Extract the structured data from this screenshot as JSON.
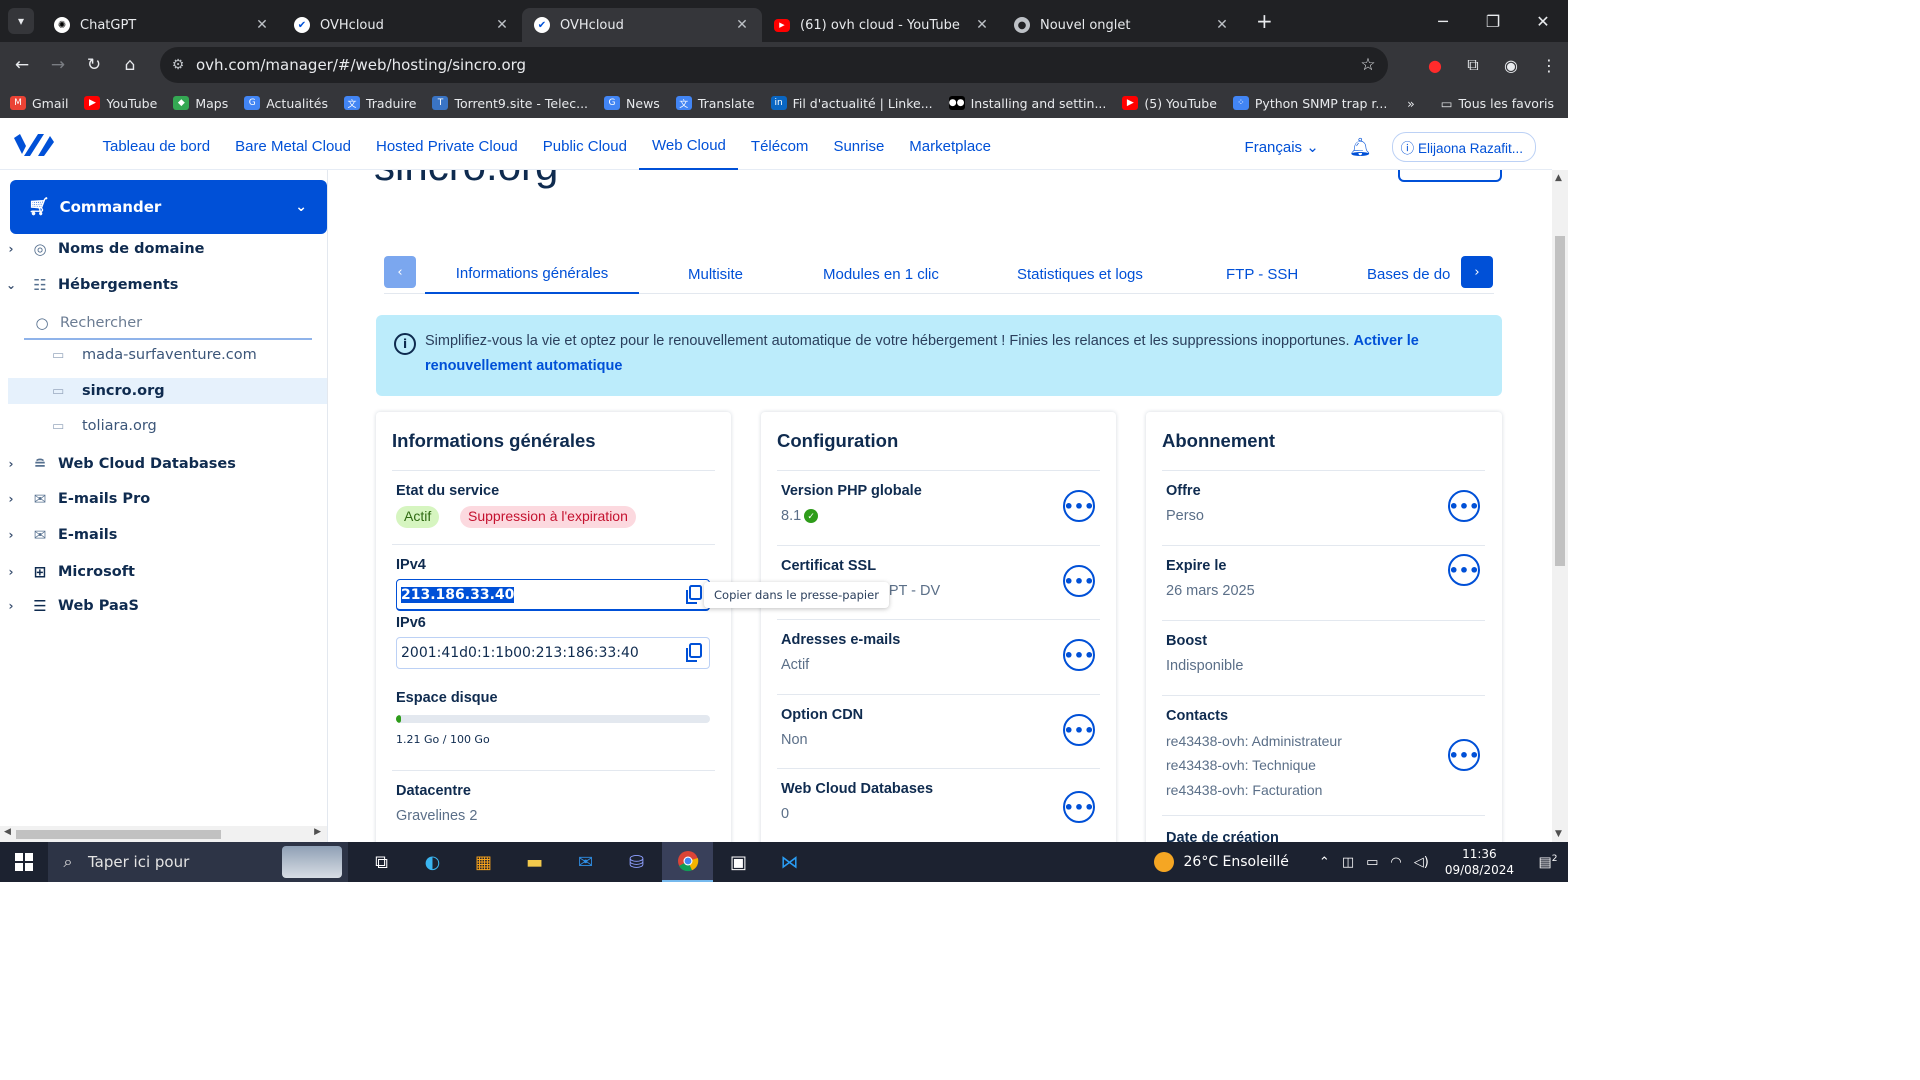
{
  "browser": {
    "tabs": [
      {
        "title": "ChatGPT",
        "icon": "chatgpt-icon"
      },
      {
        "title": "OVHcloud",
        "icon": "ovh-icon"
      },
      {
        "title": "OVHcloud",
        "icon": "ovh-icon",
        "active": true
      },
      {
        "title": "(61) ovh cloud - YouTube",
        "icon": "youtube-icon"
      },
      {
        "title": "Nouvel onglet",
        "icon": "chrome-icon"
      }
    ],
    "url": "ovh.com/manager/#/web/hosting/sincro.org",
    "bookmarks": [
      {
        "label": "Gmail",
        "icon": "gmail-icon",
        "color": "#ea4335"
      },
      {
        "label": "YouTube",
        "icon": "youtube-icon",
        "color": "#ff0000"
      },
      {
        "label": "Maps",
        "icon": "maps-icon",
        "color": "#34a853"
      },
      {
        "label": "Actualités",
        "icon": "news-icon",
        "color": "#4285f4"
      },
      {
        "label": "Traduire",
        "icon": "translate-icon",
        "color": "#4285f4"
      },
      {
        "label": "Torrent9.site - Telec...",
        "icon": "torrent-icon",
        "color": "#3a74c4"
      },
      {
        "label": "News",
        "icon": "news-icon",
        "color": "#4285f4"
      },
      {
        "label": "Translate",
        "icon": "translate-icon",
        "color": "#4285f4"
      },
      {
        "label": "Fil d'actualité | Linke...",
        "icon": "linkedin-icon",
        "color": "#0a66c2"
      },
      {
        "label": "Installing and settin...",
        "icon": "medium-icon",
        "color": "#000000"
      },
      {
        "label": "(5) YouTube",
        "icon": "youtube-icon",
        "color": "#ff0000"
      },
      {
        "label": "Python SNMP trap r...",
        "icon": "dots-icon",
        "color": "#4285f4"
      }
    ],
    "all_bookmarks": "Tous les favoris"
  },
  "header": {
    "nav": [
      "Tableau de bord",
      "Bare Metal Cloud",
      "Hosted Private Cloud",
      "Public Cloud",
      "Web Cloud",
      "Télécom",
      "Sunrise",
      "Marketplace"
    ],
    "active_nav": "Web Cloud",
    "language": "Français",
    "user": "Elijaona Razafit..."
  },
  "sidebar": {
    "order_button": "Commander",
    "items": [
      {
        "label": "Noms de domaine",
        "icon": "globe-icon",
        "expanded": false
      },
      {
        "label": "Hébergements",
        "icon": "hosting-icon",
        "expanded": true
      },
      {
        "label": "Web Cloud Databases",
        "icon": "database-icon",
        "expanded": false
      },
      {
        "label": "E-mails Pro",
        "icon": "mail-icon",
        "expanded": false
      },
      {
        "label": "E-mails",
        "icon": "mail-icon",
        "expanded": false
      },
      {
        "label": "Microsoft",
        "icon": "windows-icon",
        "expanded": false
      },
      {
        "label": "Web PaaS",
        "icon": "stack-icon",
        "expanded": false
      }
    ],
    "search_placeholder": "Rechercher",
    "sub_items": [
      "mada-surfaventure.com",
      "sincro.org",
      "toliara.org"
    ],
    "selected_sub": "sincro.org"
  },
  "main": {
    "page_title": "sincro.org",
    "tabs": [
      "Informations générales",
      "Multisite",
      "Modules en 1 clic",
      "Statistiques et logs",
      "FTP - SSH",
      "Bases de do"
    ],
    "active_tab": "Informations générales",
    "banner_text": "Simplifiez-vous la vie et optez pour le renouvellement automatique de votre hébergement ! Finies les relances et les suppressions inopportunes.",
    "banner_link": "Activer le renouvellement automatique",
    "general": {
      "title": "Informations générales",
      "service_state_label": "Etat du service",
      "badge_active": "Actif",
      "badge_deletion": "Suppression à l'expiration",
      "ipv4_label": "IPv4",
      "ipv4": "213.186.33.40",
      "ipv6_label": "IPv6",
      "ipv6": "2001:41d0:1:1b00:213:186:33:40",
      "copy_tooltip": "Copier dans le presse-papier",
      "disk_label": "Espace disque",
      "disk_usage_fraction": 0.0121,
      "disk_text": "1.21 Go / 100 Go",
      "datacenter_label": "Datacentre",
      "datacenter": "Gravelines 2"
    },
    "configuration": {
      "title": "Configuration",
      "php_label": "Version PHP globale",
      "php_value": "8.1",
      "ssl_label": "Certificat SSL",
      "ssl_value": "RYPT - DV",
      "emails_label": "Adresses e-mails",
      "emails_value": "Actif",
      "cdn_label": "Option CDN",
      "cdn_value": "Non",
      "db_label": "Web Cloud Databases",
      "db_value": "0"
    },
    "subscription": {
      "title": "Abonnement",
      "offer_label": "Offre",
      "offer_value": "Perso",
      "expires_label": "Expire le",
      "expires_value": "26 mars 2025",
      "boost_label": "Boost",
      "boost_value": "Indisponible",
      "contacts_label": "Contacts",
      "contacts": [
        "re43438-ovh: Administrateur",
        "re43438-ovh: Technique",
        "re43438-ovh: Facturation"
      ],
      "creation_label": "Date de création"
    }
  },
  "taskbar": {
    "search_placeholder": "Taper ici pour",
    "weather": "26°C  Ensoleillé",
    "time": "11:36",
    "date": "09/08/2024",
    "notifications": "2"
  },
  "colors": {
    "brand": "#0050d7",
    "banner": "#bcecfb",
    "active_badge": "#d6f5c0",
    "warn_badge": "#fcd9df"
  }
}
